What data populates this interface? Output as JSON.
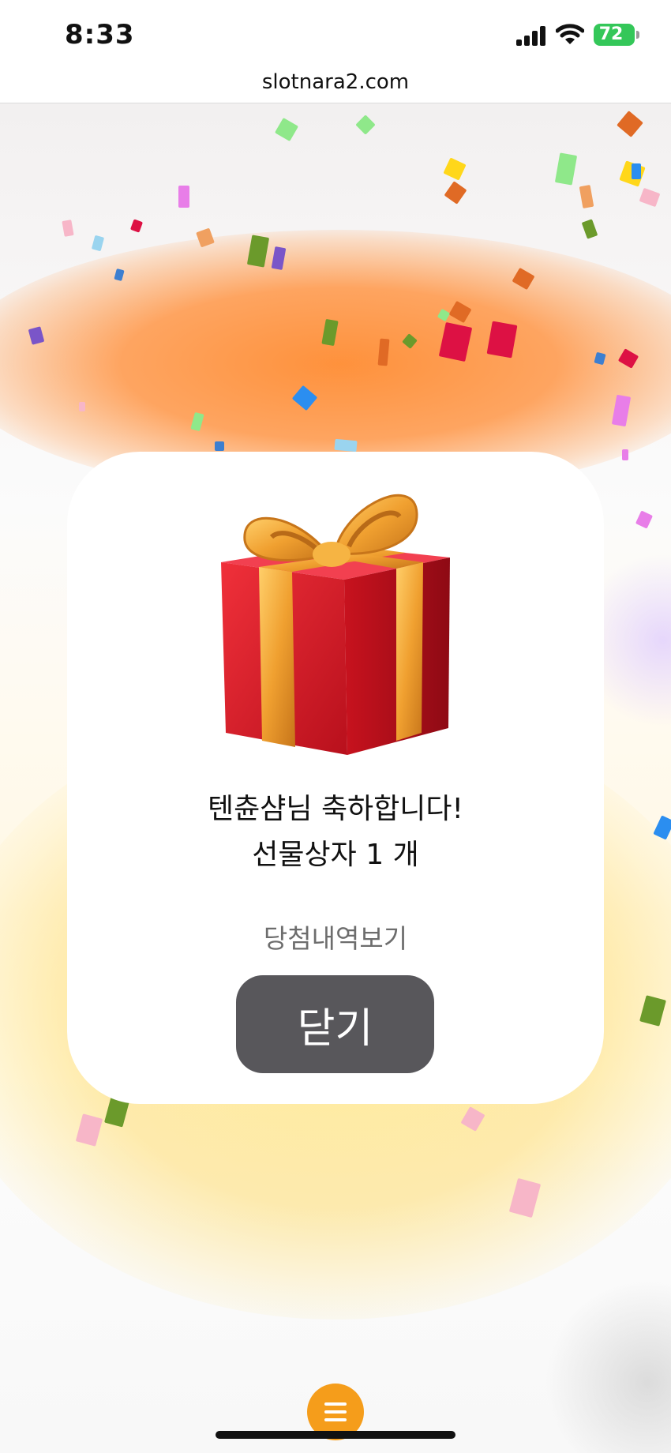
{
  "status_bar": {
    "time": "8:33",
    "battery": "72"
  },
  "browser": {
    "url": "slotnara2.com"
  },
  "modal": {
    "congrats": "텐츈샴님 축하합니다!",
    "prize": "선물상자 1 개",
    "history_link": "당첨내역보기",
    "close_label": "닫기",
    "icon": "gift-box-icon"
  },
  "menu_button": {
    "icon": "menu-icon",
    "color": "#f59d1b"
  },
  "colors": {
    "accent": "#f59d1b",
    "button": "#58575b",
    "battery": "#34c759"
  }
}
